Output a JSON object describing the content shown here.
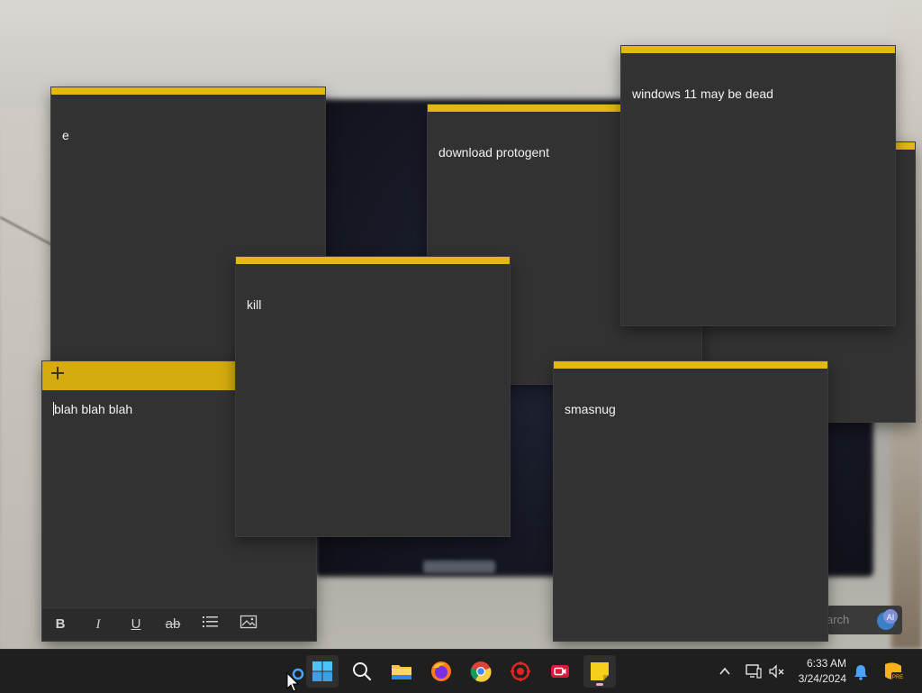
{
  "notes": [
    {
      "id": "e",
      "text": "e"
    },
    {
      "id": "download",
      "text": "download protogent"
    },
    {
      "id": "windows",
      "text": "windows 11 may be dead"
    },
    {
      "id": "kill",
      "text": "kill"
    },
    {
      "id": "smasnug",
      "text": "smasnug"
    }
  ],
  "active_note": {
    "text": "blah blah blah",
    "toolbar": {
      "bold": "B",
      "italic": "I",
      "underline": "U",
      "strikethrough": "ab"
    }
  },
  "background_search": {
    "placeholder_fragment": "arch"
  },
  "taskbar": {
    "apps": [
      "start",
      "search",
      "file-explorer",
      "firefox",
      "chrome",
      "antivirus",
      "screen-recorder",
      "sticky-notes"
    ],
    "time": "6:33 AM",
    "date": "3/24/2024"
  },
  "colors": {
    "note_accent": "#e3b814",
    "note_body": "#323232",
    "taskbar": "#1f1f1f"
  }
}
